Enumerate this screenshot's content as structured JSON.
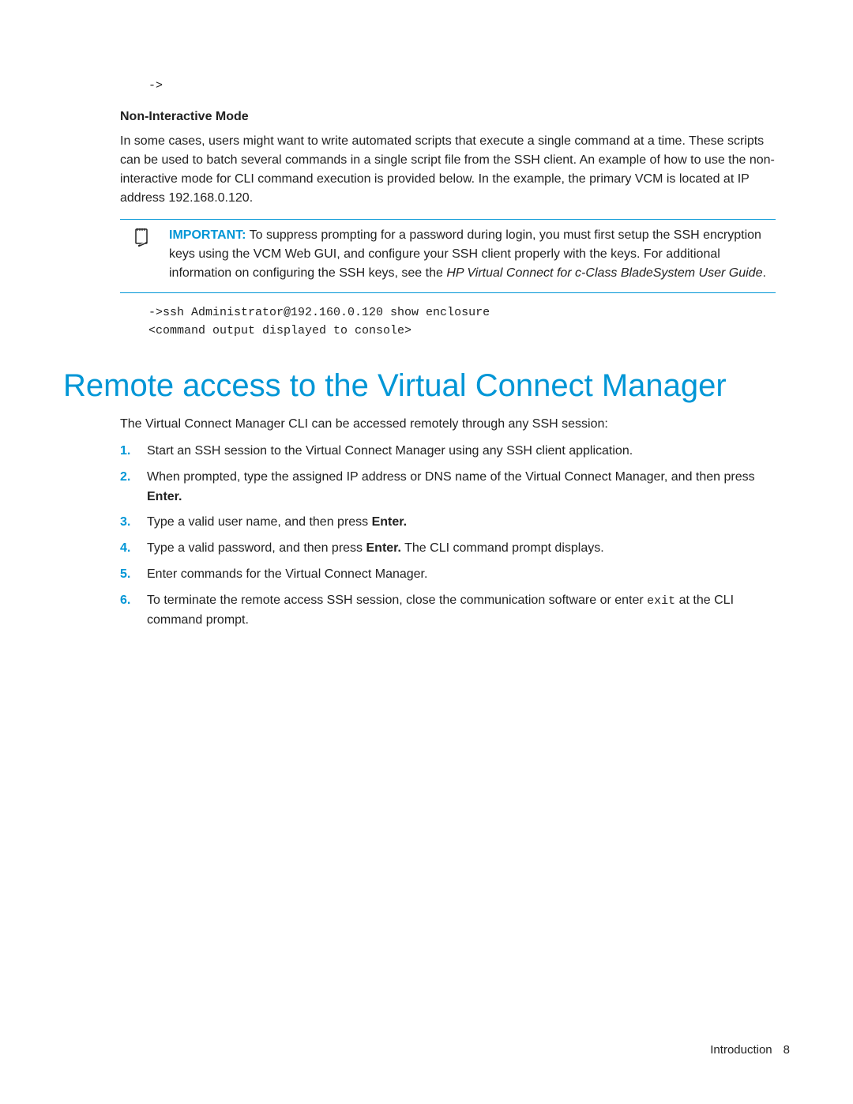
{
  "top_prompt": "->",
  "subheading": "Non-Interactive Mode",
  "paragraph1": "In some cases, users might want to write automated scripts that execute a single command at a time. These scripts can be used to batch several commands in a single script file from the SSH client. An example of how to use the non-interactive mode for CLI command execution is provided below. In the example, the primary VCM is located at IP address 192.168.0.120.",
  "callout": {
    "label": "IMPORTANT:",
    "text_a": "  To suppress prompting for a password during login, you must first setup the SSH encryption keys using the VCM Web GUI, and configure your SSH client properly with the keys. For additional information on configuring the SSH keys, see the ",
    "text_italic": "HP Virtual Connect for c-Class BladeSystem User Guide",
    "text_end": "."
  },
  "code": {
    "line1": "->ssh Administrator@192.160.0.120 show enclosure",
    "line2": "<command output displayed to console>"
  },
  "section_title": "Remote access to the Virtual Connect Manager",
  "intro": "The Virtual Connect Manager CLI can be accessed remotely through any SSH session:",
  "steps": [
    {
      "pre": "Start an SSH session to the Virtual Connect Manager using any SSH client application.",
      "bold": "",
      "post": ""
    },
    {
      "pre": "When prompted, type the assigned IP address or DNS name of the Virtual Connect Manager, and then press ",
      "bold": "Enter.",
      "post": ""
    },
    {
      "pre": "Type a valid user name, and then press ",
      "bold": "Enter.",
      "post": ""
    },
    {
      "pre": "Type a valid password, and then press ",
      "bold": "Enter.",
      "post": " The CLI command prompt displays."
    },
    {
      "pre": "Enter commands for the Virtual Connect Manager.",
      "bold": "",
      "post": ""
    },
    {
      "pre": "To terminate the remote access SSH session, close the communication software or enter ",
      "mono": "exit",
      "post": " at the CLI command prompt."
    }
  ],
  "footer": {
    "section": "Introduction",
    "page": "8"
  }
}
